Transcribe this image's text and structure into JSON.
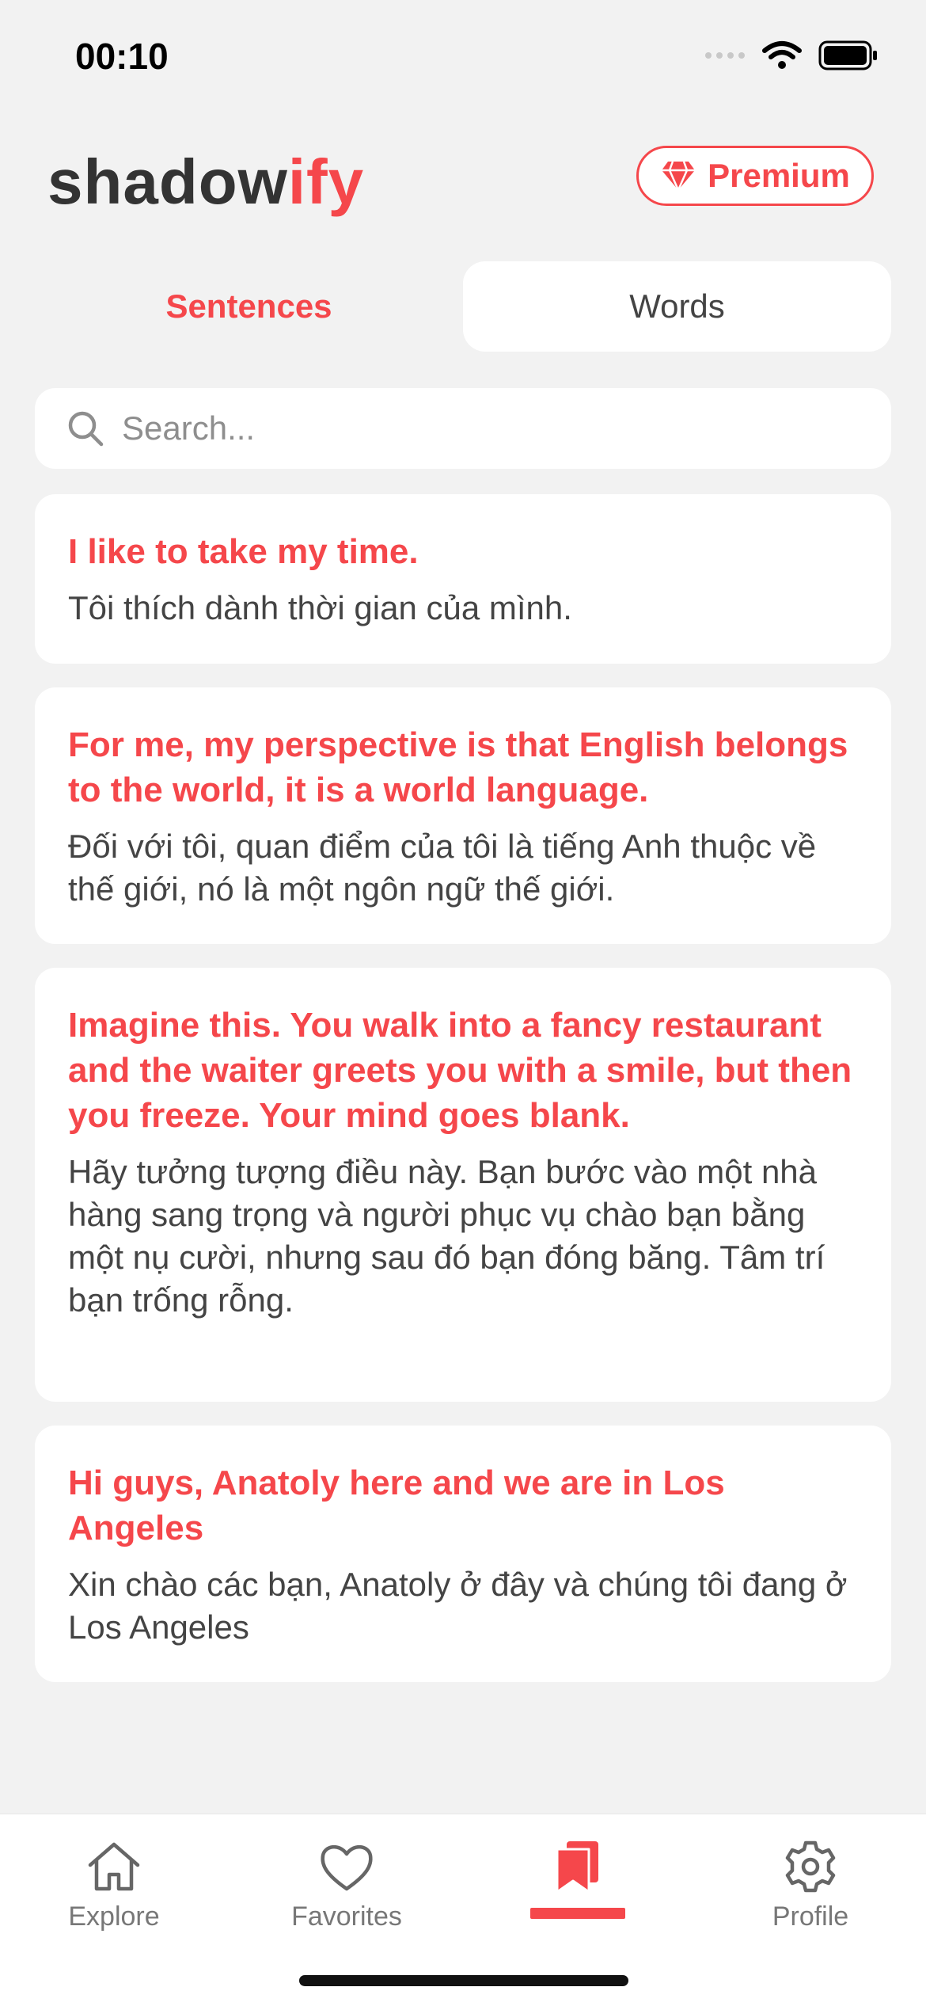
{
  "status": {
    "time": "00:10"
  },
  "header": {
    "brand_part1": "shadow",
    "brand_part2": "ify",
    "premium_label": "Premium"
  },
  "tabs": {
    "sentences": "Sentences",
    "words": "Words"
  },
  "search": {
    "placeholder": "Search..."
  },
  "cards": [
    {
      "en": "I like to take my time.",
      "vi": "Tôi thích dành thời gian của mình."
    },
    {
      "en": "For me, my perspective is that English belongs to the world, it is a world language.",
      "vi": "Đối với tôi, quan điểm của tôi là tiếng Anh thuộc về thế giới, nó là một ngôn ngữ thế giới."
    },
    {
      "en": "Imagine this. You walk into a fancy restaurant and the waiter greets you with a smile, but then you freeze. Your mind goes blank.",
      "vi": "Hãy tưởng tượng điều này. Bạn bước vào một nhà hàng sang trọng và người phục vụ chào bạn bằng một nụ cười, nhưng sau đó bạn đóng băng. Tâm trí bạn trống rỗng."
    },
    {
      "en": "Hi guys, Anatoly here and we are in Los Angeles",
      "vi": "Xin chào các bạn, Anatoly ở đây và chúng tôi đang ở Los Angeles"
    }
  ],
  "tabbar": {
    "explore": "Explore",
    "favorites": "Favorites",
    "profile": "Profile",
    "active_tab": "saved",
    "icons": [
      "home-icon",
      "heart-icon",
      "bookmark-icon",
      "gear-icon"
    ]
  },
  "colors": {
    "accent": "#f5474b",
    "background": "#f2f2f2",
    "card": "#ffffff"
  }
}
